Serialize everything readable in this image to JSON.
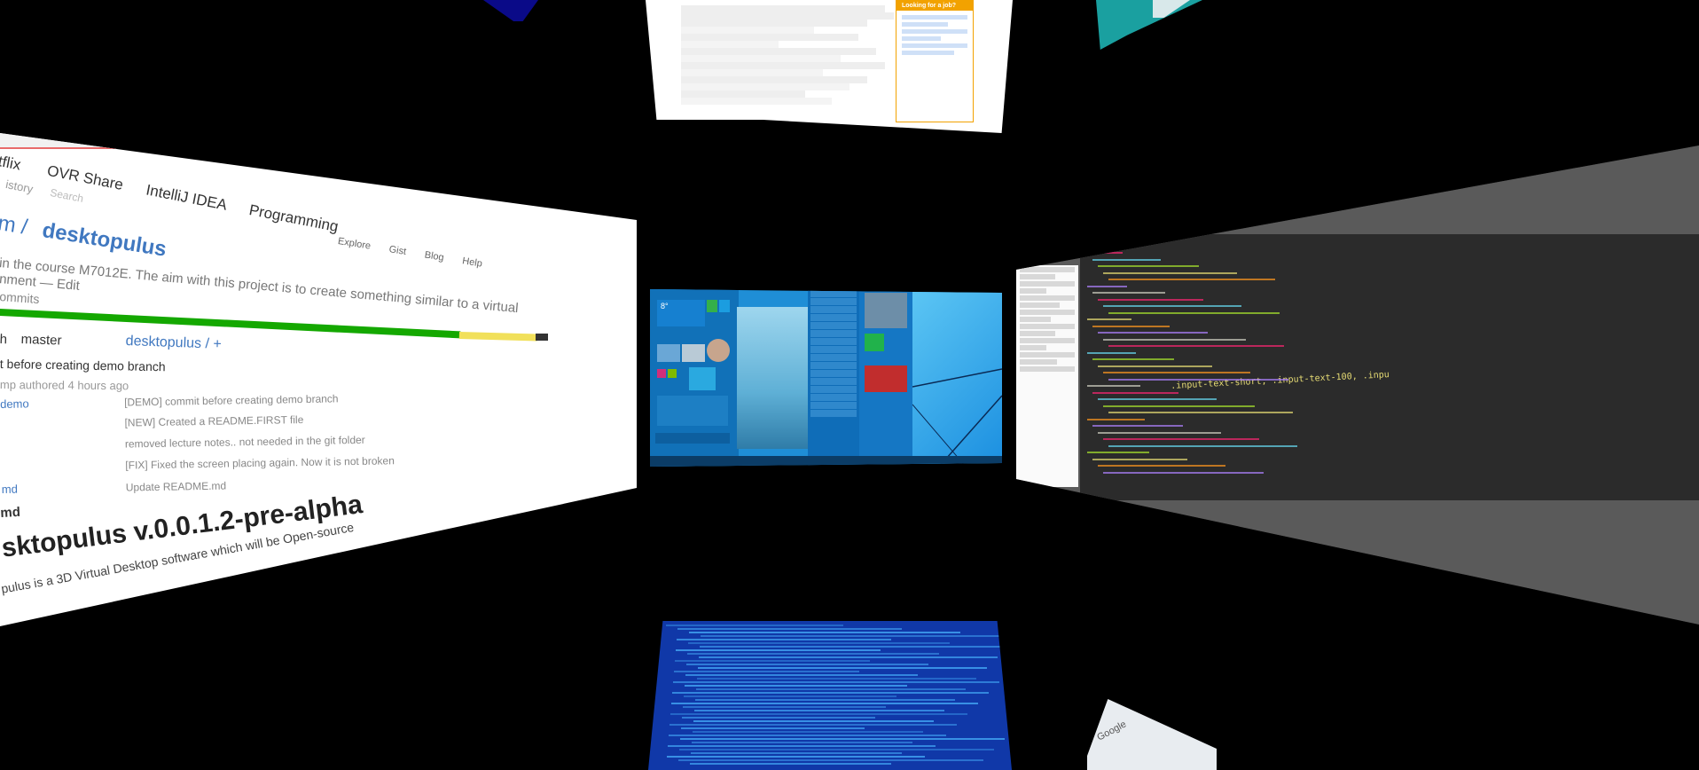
{
  "scene": {
    "app": "Desktopulus 3D virtual desktop",
    "background": "#000000"
  },
  "left_window": {
    "bookmarks": [
      "tflix",
      "OVR Share",
      "IntelliJ IDEA",
      "Programming"
    ],
    "search_hint": "Search",
    "history_fragment": "istory",
    "repo_owner": "m /",
    "repo_name": "desktopulus",
    "header_nav": [
      "Explore",
      "Gist",
      "Blog",
      "Help"
    ],
    "description": "in the course M7012E. The aim with this project is to create something similar to a virtual",
    "description_line2": "nment — Edit",
    "commits_fragment": "ommits",
    "branch_fragment": "h",
    "branch_selected": "master",
    "breadcrumb": "desktopulus / +",
    "latest_commit": "t before creating demo branch",
    "author_line": "mp authored 4 hours ago",
    "files": [
      {
        "name": "demo",
        "message": "[DEMO] commit before creating demo branch"
      },
      {
        "name": "",
        "message": "[NEW] Created a README.FIRST file"
      },
      {
        "name": "",
        "message": "removed lecture notes.. not needed in the git folder"
      },
      {
        "name": "",
        "message": "[FIX] Fixed the screen placing again. Now it is not broken"
      },
      {
        "name": "md",
        "message": "Update README.md"
      }
    ],
    "readme_file": "md",
    "readme_title": "sktopulus v.0.0.1.2-pre-alpha",
    "readme_text": "pulus is a 3D Virtual Desktop software which will be Open-source",
    "language_bar_colors": [
      "#14a800",
      "#f1e05a",
      "#333333"
    ]
  },
  "top_document": {
    "sidebar_heading": "Looking for a job?"
  },
  "center_desktop": {
    "os": "Windows 10 Technical Preview",
    "weather_temp": "8°",
    "accent": "#1f8ed6"
  },
  "right_window": {
    "editor": "CSS code editor",
    "code_fragment": ".input-text-short, .input-text-100, .inpu"
  },
  "bottom_window": {
    "type": "terminal"
  },
  "bottom_right": {
    "label": "Google"
  }
}
